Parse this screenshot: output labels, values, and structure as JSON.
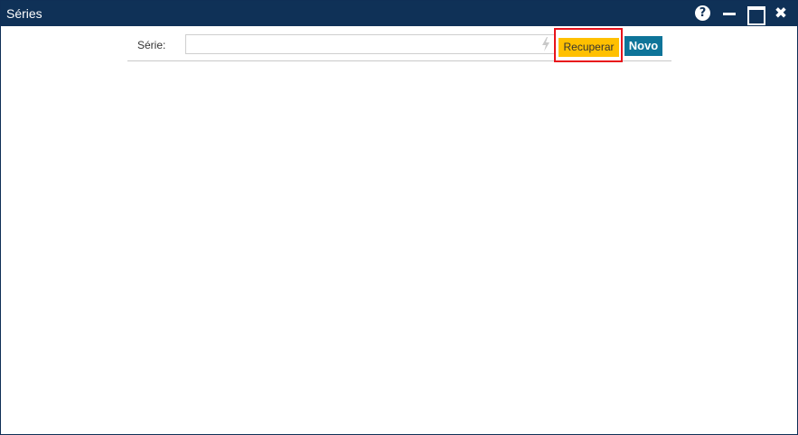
{
  "window": {
    "title": "Séries",
    "controls": {
      "help_icon": "help-icon",
      "help_glyph": "?",
      "minimize_icon": "minimize-icon",
      "maximize_icon": "maximize-icon",
      "close_icon": "close-icon",
      "close_glyph": "✖"
    }
  },
  "toolbar": {
    "serie_label": "Série:",
    "serie_value": "",
    "serie_placeholder": "",
    "bolt_icon": "lightning-icon",
    "recuperar_label": "Recuperar",
    "novo_label": "Novo"
  },
  "colors": {
    "titlebar": "#0f3157",
    "recuperar": "#ffc000",
    "novo": "#0e7499",
    "highlight": "#e8131b"
  }
}
